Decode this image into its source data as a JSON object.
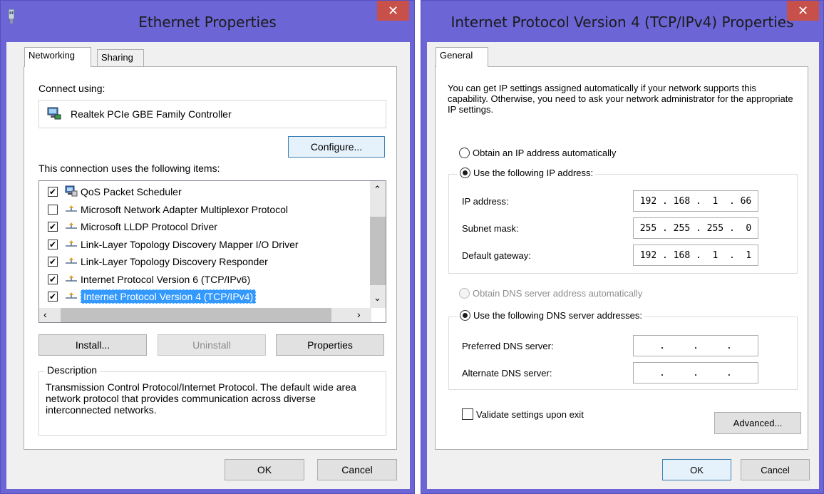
{
  "left_window": {
    "title": "Ethernet Properties",
    "close_glyph": "✕",
    "tabs": [
      "Networking",
      "Sharing"
    ],
    "connect_using_label": "Connect using:",
    "adapter_name": "Realtek PCIe GBE Family Controller",
    "configure_label": "Configure...",
    "items_label": "This connection uses the following items:",
    "items": [
      {
        "checked": true,
        "label": "QoS Packet Scheduler",
        "icon": "qos-icon"
      },
      {
        "checked": false,
        "label": "Microsoft Network Adapter Multiplexor Protocol",
        "icon": "protocol-icon"
      },
      {
        "checked": true,
        "label": "Microsoft LLDP Protocol Driver",
        "icon": "protocol-icon"
      },
      {
        "checked": true,
        "label": "Link-Layer Topology Discovery Mapper I/O Driver",
        "icon": "protocol-icon"
      },
      {
        "checked": true,
        "label": "Link-Layer Topology Discovery Responder",
        "icon": "protocol-icon"
      },
      {
        "checked": true,
        "label": "Internet Protocol Version 6 (TCP/IPv6)",
        "icon": "protocol-icon"
      },
      {
        "checked": true,
        "label": "Internet Protocol Version 4 (TCP/IPv4)",
        "icon": "protocol-icon",
        "selected": true
      }
    ],
    "install_label": "Install...",
    "uninstall_label": "Uninstall",
    "properties_label": "Properties",
    "description_label": "Description",
    "description_text": "Transmission Control Protocol/Internet Protocol. The default wide area network protocol that provides communication across diverse interconnected networks.",
    "ok_label": "OK",
    "cancel_label": "Cancel"
  },
  "right_window": {
    "title": "Internet Protocol Version 4 (TCP/IPv4) Properties",
    "close_glyph": "✕",
    "tab": "General",
    "intro": "You can get IP settings assigned automatically if your network supports this capability. Otherwise, you need to ask your network administrator for the appropriate IP settings.",
    "obtain_ip_auto": "Obtain an IP address automatically",
    "use_following_ip": "Use the following IP address:",
    "ip_address_label": "IP address:",
    "ip_address_value": "192 . 168 .  1  . 66",
    "subnet_mask_label": "Subnet mask:",
    "subnet_mask_value": "255 . 255 . 255 .  0",
    "default_gateway_label": "Default gateway:",
    "default_gateway_value": "192 . 168 .  1  .  1",
    "obtain_dns_auto": "Obtain DNS server address automatically",
    "use_following_dns": "Use the following DNS server addresses:",
    "preferred_dns_label": "Preferred DNS server:",
    "preferred_dns_value": "     .     .     .     ",
    "alternate_dns_label": "Alternate DNS server:",
    "alternate_dns_value": "     .     .     .     ",
    "validate_label": "Validate settings upon exit",
    "advanced_label": "Advanced...",
    "ok_label": "OK",
    "cancel_label": "Cancel"
  }
}
